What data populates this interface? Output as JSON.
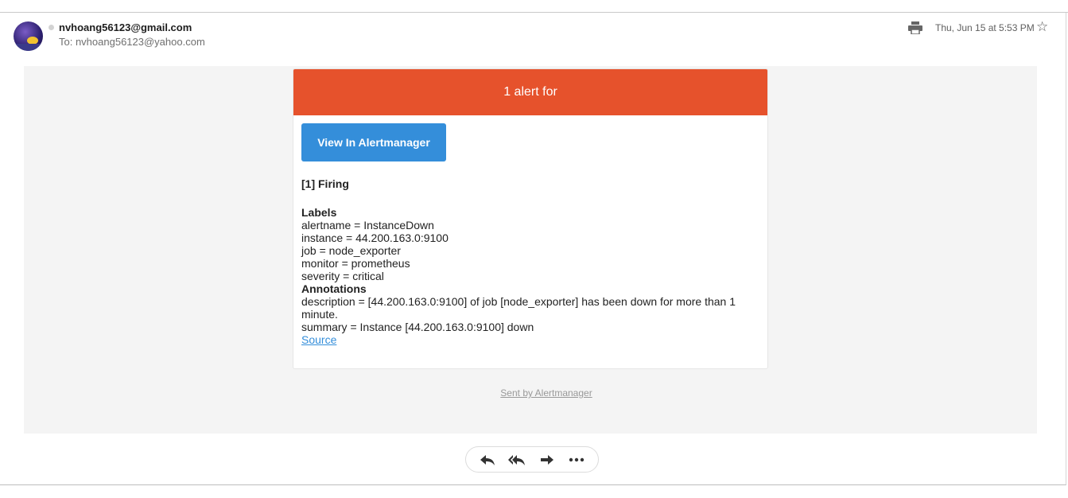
{
  "header": {
    "sender": "nvhoang56123@gmail.com",
    "recipient": "To: nvhoang56123@yahoo.com",
    "date": "Thu, Jun 15 at 5:53 PM"
  },
  "alert": {
    "title": "1 alert for",
    "button_label": "View In Alertmanager",
    "firing": "[1] Firing",
    "labels_heading": "Labels",
    "labels": [
      "alertname = InstanceDown",
      "instance = 44.200.163.0:9100",
      "job = node_exporter",
      "monitor = prometheus",
      "severity = critical"
    ],
    "annotations_heading": "Annotations",
    "annotations": [
      "description = [44.200.163.0:9100] of job [node_exporter] has been down for more than 1 minute.",
      "summary = Instance [44.200.163.0:9100] down"
    ],
    "source_link": "Source"
  },
  "footer": {
    "sent_by": "Sent by Alertmanager"
  },
  "colors": {
    "header_bg": "#e6522c",
    "button_bg": "#348eda",
    "body_bg": "#f4f4f4"
  },
  "icons": [
    "print-icon",
    "star-icon",
    "reply-icon",
    "reply-all-icon",
    "forward-icon",
    "more-icon"
  ]
}
